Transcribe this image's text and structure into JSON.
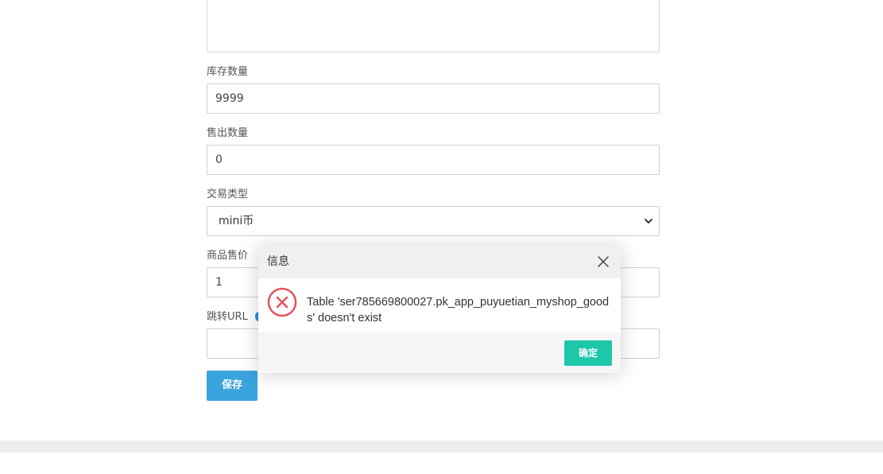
{
  "form": {
    "stock": {
      "label": "库存数量",
      "value": "9999"
    },
    "sold": {
      "label": "售出数量",
      "value": "0"
    },
    "trade_type": {
      "label": "交易类型",
      "selected": "mini币"
    },
    "price": {
      "label": "商品售价",
      "value": "1"
    },
    "redirect_url": {
      "label": "跳转URL",
      "value": ""
    },
    "save_label": "保存"
  },
  "dialog": {
    "title": "信息",
    "message": "Table 'ser785669800027.pk_app_puyuetian_myshop_goods' doesn't exist",
    "ok_label": "确定",
    "icon": "error-circle-icon"
  },
  "colors": {
    "save_button": "#3ba3dd",
    "ok_button": "#1fc7a9",
    "error_icon": "#e8505f",
    "info_dot": "#2a8fd0"
  }
}
